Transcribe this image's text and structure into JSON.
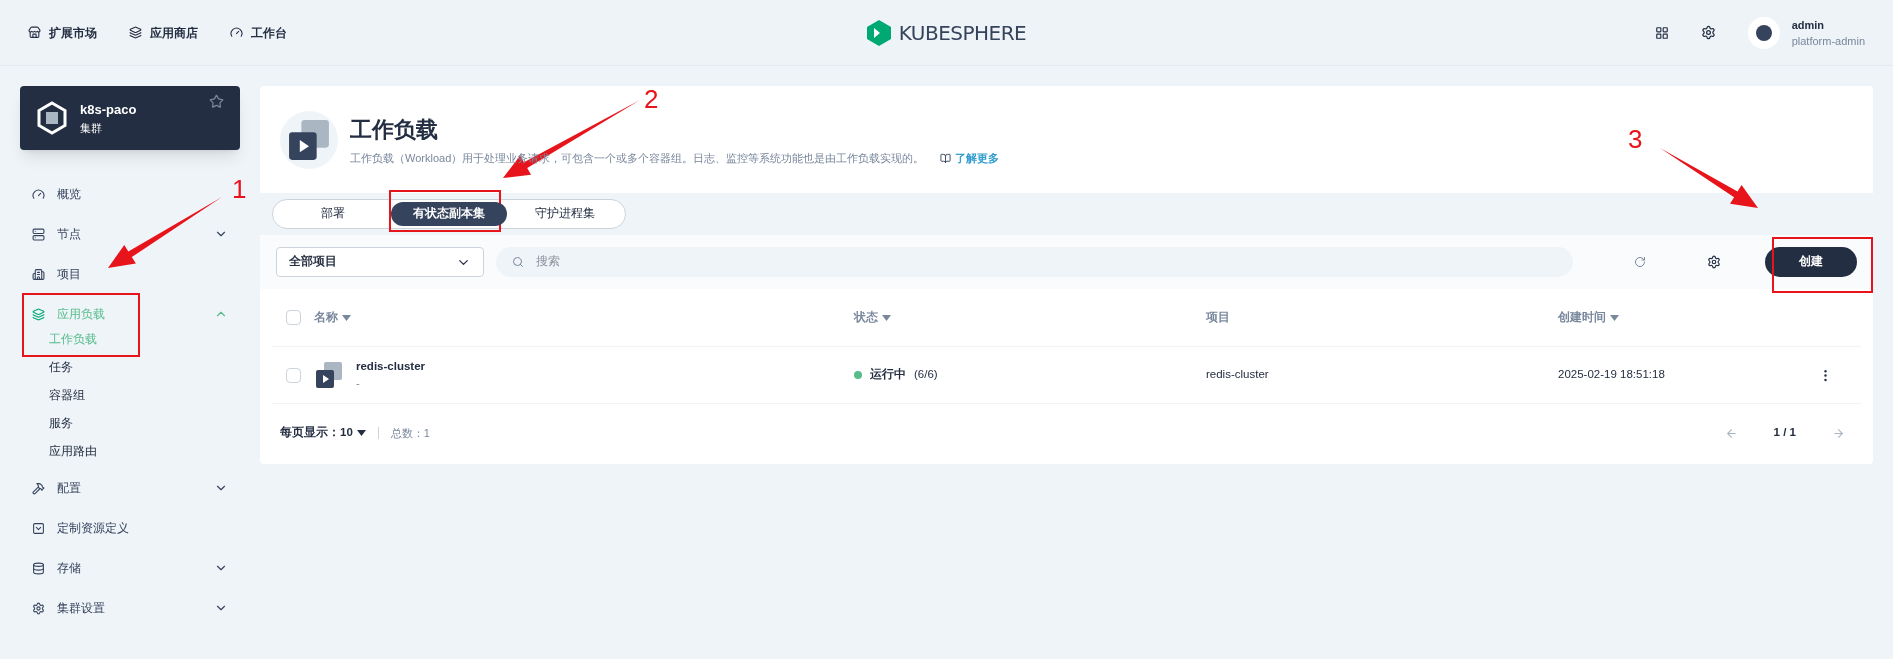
{
  "top_nav": [
    {
      "label": "扩展市场"
    },
    {
      "label": "应用商店"
    },
    {
      "label": "工作台"
    }
  ],
  "logo": {
    "text": "KUBESPHERE"
  },
  "user": {
    "name": "admin",
    "role": "platform-admin"
  },
  "cluster": {
    "name": "k8s-paco",
    "type": "集群"
  },
  "sidebar": {
    "items": [
      {
        "label": "概览",
        "selected": false
      },
      {
        "label": "节点",
        "selected": false,
        "expanded": false
      },
      {
        "label": "项目",
        "selected": false
      },
      {
        "label": "应用负载",
        "selected": true,
        "expanded": true,
        "children": [
          {
            "label": "工作负载",
            "selected": true
          },
          {
            "label": "任务",
            "selected": false
          },
          {
            "label": "容器组",
            "selected": false
          },
          {
            "label": "服务",
            "selected": false
          },
          {
            "label": "应用路由",
            "selected": false
          }
        ]
      },
      {
        "label": "配置",
        "selected": false,
        "expanded": false
      },
      {
        "label": "定制资源定义",
        "selected": false
      },
      {
        "label": "存储",
        "selected": false,
        "expanded": false
      },
      {
        "label": "集群设置",
        "selected": false,
        "expanded": false
      }
    ]
  },
  "header": {
    "title": "工作负载",
    "description": "工作负载（Workload）用于处理业务请求，可包含一个或多个容器组。日志、监控等系统功能也是由工作负载实现的。",
    "link": "了解更多"
  },
  "tabs": [
    {
      "label": "部署",
      "selected": false
    },
    {
      "label": "有状态副本集",
      "selected": true
    },
    {
      "label": "守护进程集",
      "selected": false
    }
  ],
  "toolbar": {
    "project_select": "全部项目",
    "search": {
      "placeholder": "搜索"
    },
    "create_button": "创建"
  },
  "table": {
    "all_checked": false,
    "columns": [
      {
        "label": "名称",
        "sortable": true
      },
      {
        "label": "状态",
        "sortable": true
      },
      {
        "label": "项目",
        "sortable": false
      },
      {
        "label": "创建时间",
        "sortable": true
      }
    ],
    "rows": [
      {
        "checked": false,
        "name": "redis-cluster",
        "subtitle": "-",
        "status": "运行中",
        "count": "(6/6)",
        "color": "#55bc8a",
        "project": "redis-cluster",
        "created": "2025-02-19 18:51:18"
      }
    ]
  },
  "footer": {
    "page_size_label": "每页显示：",
    "page_size": "10",
    "total": "总数：1",
    "page": "1 / 1"
  },
  "annotations": [
    {
      "label": "1"
    },
    {
      "label": "2"
    },
    {
      "label": "3"
    }
  ]
}
